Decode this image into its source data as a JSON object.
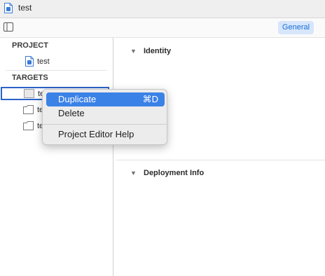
{
  "window": {
    "title": "test",
    "icon": "project-file-icon"
  },
  "toolbar": {
    "sidebar_icon": "sidebar-toggle-icon",
    "tab_general": "General"
  },
  "sidebar": {
    "project_header": "PROJECT",
    "project_item": "test",
    "targets_header": "TARGETS",
    "targets": [
      {
        "label": "test",
        "selected": true
      },
      {
        "label": "test",
        "selected": false
      },
      {
        "label": "test",
        "selected": false
      }
    ]
  },
  "editor": {
    "sections": [
      {
        "label": "Identity"
      },
      {
        "label": "Deployment Info"
      }
    ],
    "disclosure_glyph": "▼"
  },
  "context_menu": {
    "items": [
      {
        "label": "Duplicate",
        "shortcut": "⌘D",
        "highlighted": true
      },
      {
        "label": "Delete"
      },
      {
        "label": "Project Editor Help"
      }
    ]
  },
  "colors": {
    "accent": "#3b82e7",
    "tab_bg": "#d7e6fb",
    "tab_text": "#1a6fd6",
    "selection_border": "#2b62c9"
  }
}
